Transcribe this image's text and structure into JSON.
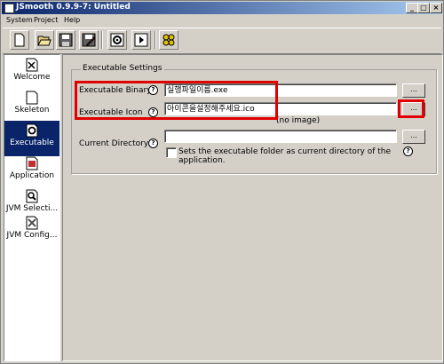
{
  "window": {
    "title": "JSmooth 0.9.9-7: Untitled"
  },
  "menu": [
    {
      "label": "System"
    },
    {
      "label": "Project"
    },
    {
      "label": "Help"
    }
  ],
  "toolbar": {
    "buttons": [
      {
        "name": "new-project-button",
        "icon": "new-document-icon"
      },
      {
        "name": "open-project-button",
        "icon": "folder-open-icon"
      },
      {
        "name": "save-project-button",
        "icon": "floppy-disk-icon"
      },
      {
        "name": "save-as-button",
        "icon": "floppy-edit-icon"
      },
      {
        "name": "compile-button",
        "icon": "gear-icon"
      },
      {
        "name": "run-button",
        "icon": "play-icon"
      },
      {
        "name": "about-button",
        "icon": "multi-gear-icon"
      }
    ]
  },
  "sidebar": {
    "items": [
      {
        "label": "Welcome",
        "icon": "welcome-icon",
        "selected": false
      },
      {
        "label": "Skeleton",
        "icon": "document-icon",
        "selected": false
      },
      {
        "label": "Executable",
        "icon": "gear-document-icon",
        "selected": true
      },
      {
        "label": "Application",
        "icon": "application-icon",
        "selected": false
      },
      {
        "label": "JVM Selecti...",
        "icon": "magnifier-document-icon",
        "selected": false
      },
      {
        "label": "JVM Config...",
        "icon": "tools-document-icon",
        "selected": false
      }
    ]
  },
  "executable_settings": {
    "group_title": "Executable Settings",
    "binary": {
      "label": "Executable Binary",
      "value": "실행파일이름.exe",
      "browse_label": "..."
    },
    "icon": {
      "label": "Executable Icon",
      "value": "아이콘을설정해주세요.ico",
      "browse_label": "...",
      "preview_text": "(no image)"
    },
    "directory": {
      "label": "Current Directory",
      "value": "",
      "browse_label": "...",
      "checkbox_label": "Sets the executable folder as current directory of the application.",
      "checked": false
    }
  },
  "colors": {
    "highlight": "#e00000",
    "selection": "#0a246a",
    "title_gradient_start": "#0a246a"
  }
}
